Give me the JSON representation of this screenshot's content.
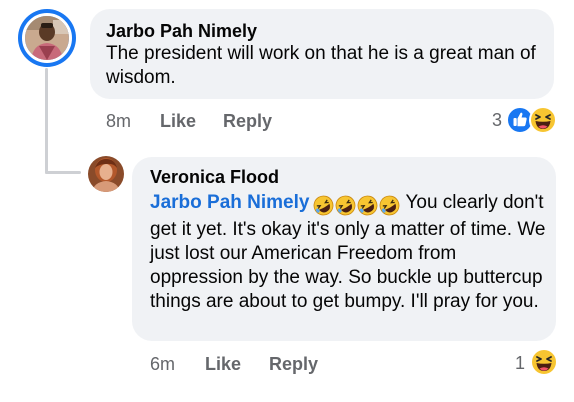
{
  "comments": [
    {
      "author": "Jarbo Pah Nimely",
      "text": "The president will work on that he is a great man of wisdom.",
      "time": "8m",
      "like_label": "Like",
      "reply_label": "Reply",
      "reaction_count": "3",
      "reactions": [
        "like-icon",
        "haha-icon"
      ]
    },
    {
      "author": "Veronica Flood",
      "mention": "Jarbo Pah Nimely",
      "mention_emojis": [
        "rolling-on-floor-laughing-icon",
        "rolling-on-floor-laughing-icon",
        "rolling-on-floor-laughing-icon",
        "rolling-on-floor-laughing-icon"
      ],
      "text": "You clearly don't get it yet. It's okay it's only a matter of time. We just lost our American Freedom from oppression by the way. So buckle up buttercup things are about to get bumpy. I'll pray for you.",
      "time": "6m",
      "like_label": "Like",
      "reply_label": "Reply",
      "reaction_count": "1",
      "reactions": [
        "haha-icon"
      ]
    }
  ],
  "colors": {
    "bubble": "#f0f2f5",
    "mention": "#1a6ed8",
    "meta": "#65676b",
    "like_blue": "#1877f2",
    "emoji_yellow": "#f7c531"
  }
}
